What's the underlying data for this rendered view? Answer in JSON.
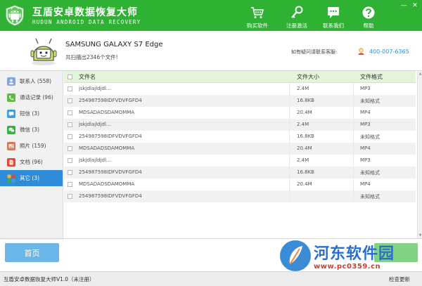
{
  "app": {
    "title": "互盾安卓数据恢复大师",
    "subtitle": "HUDUN ANDROID DATA RECOVERY",
    "minimize": "—",
    "close": "✕"
  },
  "topnav": {
    "buy": "购买软件",
    "register": "注册激活",
    "contact": "联系我们",
    "help": "帮助"
  },
  "device": {
    "name": "SAMSUNG  GALAXY S7 Edge",
    "scan_result": "共扫描出2346个文件!"
  },
  "support": {
    "label": "如有疑问请联系客服:",
    "phone": "400-007-6365"
  },
  "sidebar": {
    "items": [
      {
        "label": "联系人  (558)",
        "icon": "contacts-icon",
        "color": "#7fa6d6"
      },
      {
        "label": "通话记录  (96)",
        "icon": "phone-icon",
        "color": "#5dba47"
      },
      {
        "label": "短信  (3)",
        "icon": "sms-icon",
        "color": "#3aa0e0"
      },
      {
        "label": "微信  (3)",
        "icon": "wechat-icon",
        "color": "#34b340"
      },
      {
        "label": "照片  (159)",
        "icon": "photo-icon",
        "color": "#e8734a"
      },
      {
        "label": "文档  (96)",
        "icon": "document-icon",
        "color": "#e2493b"
      },
      {
        "label": "其它  (3)",
        "icon": "other-icon",
        "color": "#f2b233"
      }
    ],
    "active_index": 6
  },
  "table": {
    "headers": {
      "name": "文件名",
      "size": "文件大小",
      "format": "文件格式"
    },
    "rows": [
      {
        "name": "jskjdlajldjdl...",
        "size": "2.4M",
        "format": "MP3"
      },
      {
        "name": "254987598IDFVDVFGFD4",
        "size": "16.8KB",
        "format": "未知格式"
      },
      {
        "name": "MDSADADSDAMOMMA",
        "size": "20.4M",
        "format": "MP4"
      },
      {
        "name": "jskjdlajldjdl...",
        "size": "2.4M",
        "format": "MP3"
      },
      {
        "name": "254987598IDFVDVFGFD4",
        "size": "16.8KB",
        "format": "未知格式"
      },
      {
        "name": "MDSADADSDAMOMMA",
        "size": "20.4M",
        "format": "MP4"
      },
      {
        "name": "jskjdlajldjdl...",
        "size": "2.4M",
        "format": "MP3"
      },
      {
        "name": "254987598IDFVDVFGFD4",
        "size": "16.8KB",
        "format": "未知格式"
      },
      {
        "name": "MDSADADSDAMOMMA",
        "size": "20.4M",
        "format": "MP4"
      },
      {
        "name": "254987598IDFVDVFGFD4",
        "size": "",
        "format": "未知格式"
      }
    ]
  },
  "bottom": {
    "home_label": "首页",
    "watermark_title": "河东软件园",
    "watermark_url": "www.pc0359.cn"
  },
  "status": {
    "version": "互盾安卓数据恢复大师V1.0（未注册）",
    "update": "检查更新"
  },
  "colors": {
    "brand_green": "#2fb233",
    "accent_blue": "#2f8cd9",
    "header_green": "#e2f4d9"
  }
}
